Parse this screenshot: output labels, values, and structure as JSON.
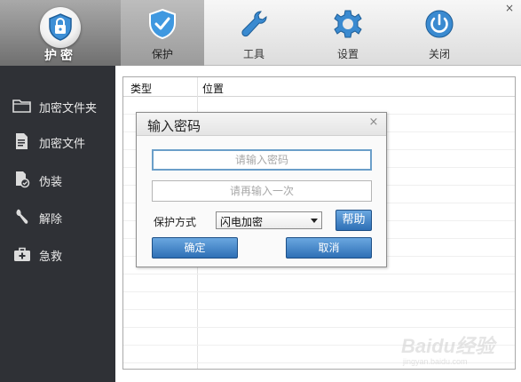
{
  "header": {
    "logo_label": "护密",
    "tabs": [
      {
        "label": "保护",
        "icon": "shield-check-icon",
        "active": true
      },
      {
        "label": "工具",
        "icon": "wrench-icon",
        "active": false
      },
      {
        "label": "设置",
        "icon": "gear-icon",
        "active": false
      },
      {
        "label": "关闭",
        "icon": "power-icon",
        "active": false
      }
    ],
    "close_glyph": "×"
  },
  "sidebar": {
    "items": [
      {
        "label": "加密文件夹",
        "icon": "folder-icon"
      },
      {
        "label": "加密文件",
        "icon": "file-icon"
      },
      {
        "label": "伪装",
        "icon": "disguise-icon"
      },
      {
        "label": "解除",
        "icon": "unlock-icon"
      },
      {
        "label": "急救",
        "icon": "first-aid-kit-icon"
      }
    ]
  },
  "list": {
    "columns": [
      "类型",
      "位置"
    ],
    "rows": []
  },
  "dialog": {
    "title": "输入密码",
    "close_glyph": "×",
    "password_placeholder": "请输入密码",
    "confirm_placeholder": "请再输入一次",
    "mode_label": "保护方式",
    "mode_selected": "闪电加密",
    "help_label": "帮助",
    "ok_label": "确定",
    "cancel_label": "取消"
  },
  "watermark": {
    "main": "Baidu经验",
    "sub": "jingyan.baidu.com"
  },
  "colors": {
    "accent_blue": "#2e6fb5",
    "sidebar_bg": "#2f3136",
    "logo_tab_bg": "#8a8a8a"
  }
}
